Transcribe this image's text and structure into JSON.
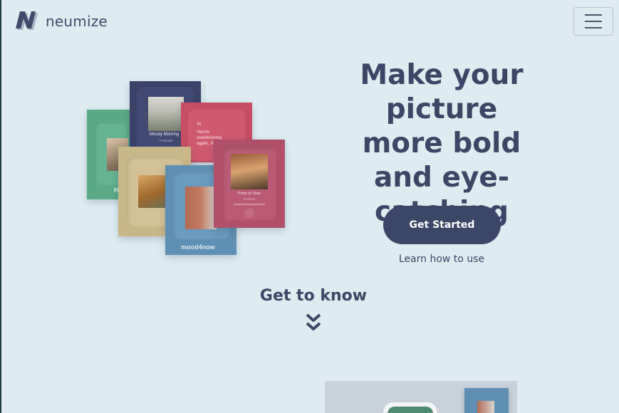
{
  "brand": {
    "name": "neumize",
    "logo_icon": "n-logo-icon"
  },
  "nav": {
    "menu_icon": "hamburger-icon"
  },
  "hero": {
    "headline": "Make your picture more bold and eye-catching",
    "cta_label": "Get Started",
    "learn_link": "Learn how to use"
  },
  "cards": {
    "navy_title": "Moody Morning",
    "navy_sub": "Podcasts",
    "red_quote": "You're overthinking again, this.",
    "pink_title": "Point of View",
    "pink_sub": "Podcast",
    "green_label": "H",
    "blue_label": "mood4now"
  },
  "section": {
    "title": "Get to know",
    "chevron_icon": "chevron-double-down-icon"
  },
  "colors": {
    "background": "#deecf2",
    "primary": "#3a4766",
    "card_green": "#5aaa88",
    "card_navy": "#3b4268",
    "card_red": "#c64d62",
    "card_tan": "#c9b78a",
    "card_blue": "#5f8fb2",
    "card_pink": "#b0506a"
  }
}
